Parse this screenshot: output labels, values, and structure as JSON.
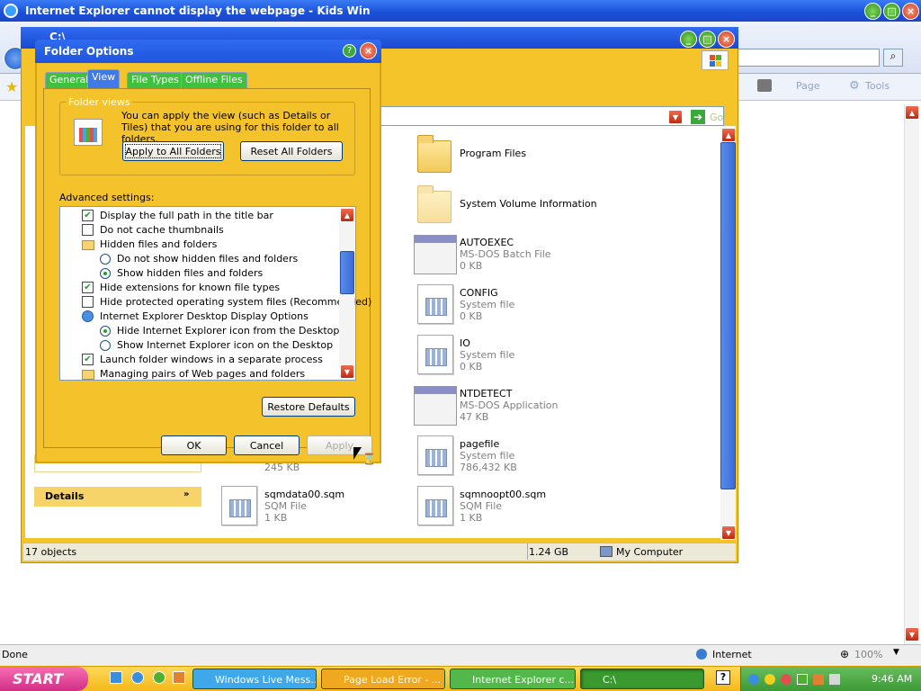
{
  "ie": {
    "title": "Internet Explorer cannot display the webpage - Kids Win",
    "status_done": "Done",
    "zone": "Internet",
    "zoom": "100%",
    "cmd_page": "Page",
    "cmd_tools": "Tools"
  },
  "explorer": {
    "title_short": "C:\\",
    "address_go": "Go",
    "status_objects": "17 objects",
    "status_size": "1.24 GB",
    "status_location": "My Computer",
    "details_label": "Details",
    "partial_size": "245 KB",
    "files": [
      {
        "name": "Program Files",
        "type": "",
        "size": ""
      },
      {
        "name": "System Volume Information",
        "type": "",
        "size": ""
      },
      {
        "name": "AUTOEXEC",
        "type": "MS-DOS Batch File",
        "size": "0 KB"
      },
      {
        "name": "CONFIG",
        "type": "System file",
        "size": "0 KB"
      },
      {
        "name": "IO",
        "type": "System file",
        "size": "0 KB"
      },
      {
        "name": "NTDETECT",
        "type": "MS-DOS Application",
        "size": "47 KB"
      },
      {
        "name": "pagefile",
        "type": "System file",
        "size": "786,432 KB"
      },
      {
        "name": "sqmnoopt00.sqm",
        "type": "SQM File",
        "size": "1 KB"
      },
      {
        "name": "sqmdata00.sqm",
        "type": "SQM File",
        "size": "1 KB"
      }
    ]
  },
  "dialog": {
    "title": "Folder Options",
    "tabs": [
      "General",
      "View",
      "File Types",
      "Offline Files"
    ],
    "folder_views_legend": "Folder views",
    "folder_views_text": "You can apply the view (such as Details or Tiles) that you are using for this folder to all folders.",
    "apply_all": "Apply to All Folders",
    "reset_all": "Reset All Folders",
    "advanced_label": "Advanced settings:",
    "settings": [
      {
        "kind": "check",
        "checked": true,
        "indent": 0,
        "label": "Display the full path in the title bar"
      },
      {
        "kind": "check",
        "checked": false,
        "indent": 0,
        "label": "Do not cache thumbnails"
      },
      {
        "kind": "folder",
        "indent": 0,
        "label": "Hidden files and folders"
      },
      {
        "kind": "radio",
        "checked": false,
        "indent": 1,
        "label": "Do not show hidden files and folders"
      },
      {
        "kind": "radio",
        "checked": true,
        "indent": 1,
        "label": "Show hidden files and folders"
      },
      {
        "kind": "check",
        "checked": true,
        "indent": 0,
        "label": "Hide extensions for known file types"
      },
      {
        "kind": "check",
        "checked": false,
        "indent": 0,
        "label": "Hide protected operating system files (Recommended)"
      },
      {
        "kind": "ie",
        "indent": 0,
        "label": "Internet Explorer Desktop Display Options"
      },
      {
        "kind": "radio",
        "checked": true,
        "indent": 1,
        "label": "Hide Internet Explorer icon from the Desktop"
      },
      {
        "kind": "radio",
        "checked": false,
        "indent": 1,
        "label": "Show Internet Explorer icon on the Desktop"
      },
      {
        "kind": "check",
        "checked": true,
        "indent": 0,
        "label": "Launch folder windows in a separate process"
      },
      {
        "kind": "folder",
        "indent": 0,
        "label": "Managing pairs of Web pages and folders"
      }
    ],
    "restore_defaults": "Restore Defaults",
    "ok": "OK",
    "cancel": "Cancel",
    "apply": "Apply"
  },
  "taskbar": {
    "start": "START",
    "tasks": [
      "Windows Live Mess...",
      "Page Load Error - ...",
      "Internet Explorer c...",
      "C:\\"
    ],
    "clock": "9:46 AM"
  }
}
